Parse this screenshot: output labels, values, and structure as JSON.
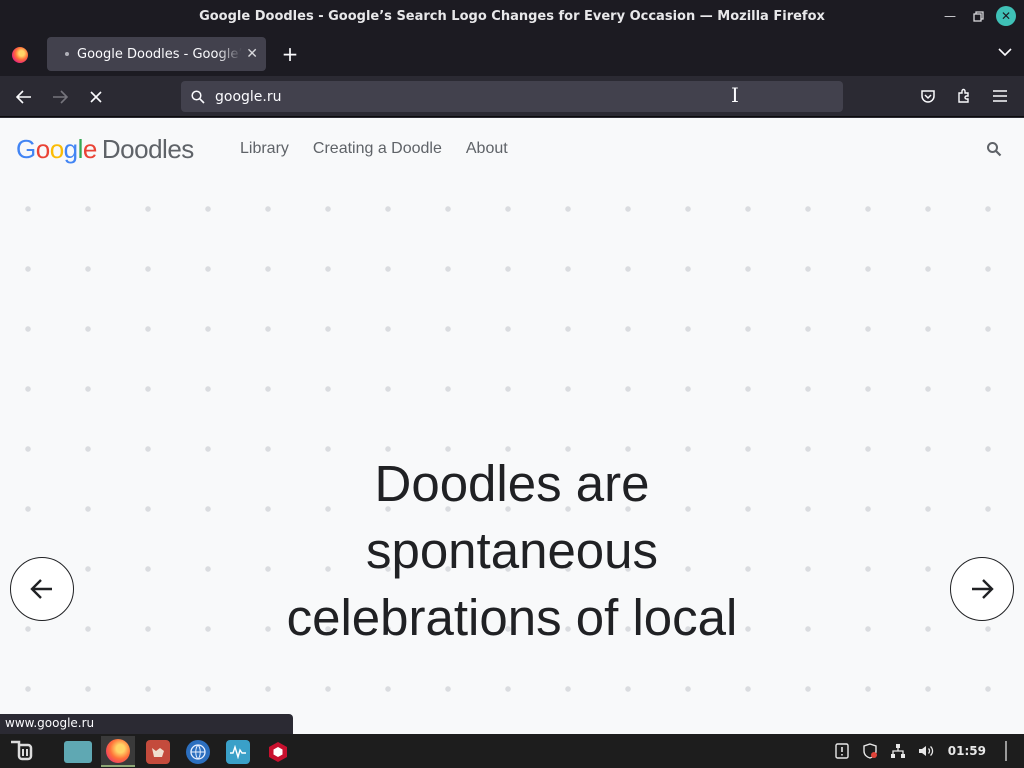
{
  "window": {
    "title": "Google Doodles - Google’s Search Logo Changes for Every Occasion — Mozilla Firefox",
    "controls": [
      "minimize-icon",
      "maximize-icon",
      "close-icon"
    ]
  },
  "tabs": [
    {
      "label": "Google Doodles - Google’s Search Logo Changes for Every Occasion",
      "loading": true
    }
  ],
  "toolbar": {
    "url": "google.ru",
    "icons": [
      "back-arrow-icon",
      "forward-arrow-icon",
      "stop-icon",
      "pocket-icon",
      "extensions-icon",
      "menu-icon"
    ]
  },
  "site": {
    "logo": {
      "google": "Google",
      "doodles": "Doodles"
    },
    "nav": [
      "Library",
      "Creating a Doodle",
      "About"
    ],
    "hero_lines": [
      "Doodles are",
      "spontaneous",
      "celebrations of local"
    ]
  },
  "status_url": "www.google.ru",
  "taskbar": {
    "apps": [
      "mint-menu-icon",
      "files-icon",
      "firefox-icon",
      "gimp-icon",
      "browser-globe-icon",
      "system-monitor-icon",
      "hexagon-app-icon"
    ],
    "clock": "01:59",
    "tray": [
      "update-icon",
      "shield-icon",
      "network-icon",
      "volume-icon"
    ]
  },
  "colors": {
    "google_blue": "#4285f4",
    "google_red": "#ea4335",
    "google_yellow": "#fbbc05",
    "google_green": "#34a853",
    "firefox_dark": "#1c1b22",
    "taskbar": "#1d1d1d",
    "active_app_underline": "#8fa876"
  }
}
